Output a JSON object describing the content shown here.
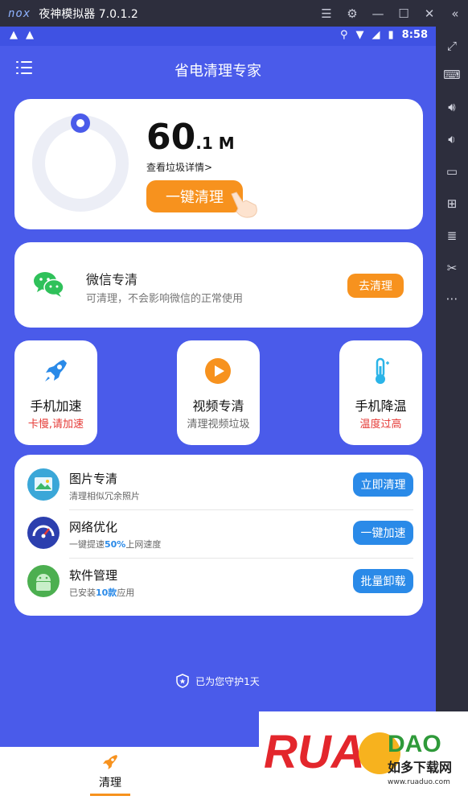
{
  "emulator": {
    "logo": "nox",
    "title": "夜神模拟器 7.0.1.2",
    "controls": [
      "menu-icon",
      "gear-icon",
      "minimize-icon",
      "maximize-icon",
      "close-icon",
      "collapse-icon"
    ]
  },
  "statusbar": {
    "time": "8:58"
  },
  "app": {
    "title": "省电清理专家",
    "junk": {
      "value": "60",
      "decimal": ".1 M",
      "detail_link": "查看垃圾详情>",
      "button": "一键清理"
    },
    "wechat": {
      "title": "微信专清",
      "subtitle": "可清理，不会影响微信的正常使用",
      "button": "去清理"
    },
    "tiles": [
      {
        "title": "手机加速",
        "subtitle": "卡慢,请加速",
        "subtitle_color": "#e53935"
      },
      {
        "title": "视频专清",
        "subtitle": "清理视频垃圾",
        "subtitle_color": "#666666"
      },
      {
        "title": "手机降温",
        "subtitle": "温度过高",
        "subtitle_color": "#e53935"
      }
    ],
    "list": [
      {
        "title": "图片专清",
        "subtitle": "清理相似冗余照片",
        "button": "立即清理"
      },
      {
        "title": "网络优化",
        "subtitle_pre": "一键提速",
        "subtitle_num": "50%",
        "subtitle_post": "上网速度",
        "button": "一键加速"
      },
      {
        "title": "软件管理",
        "subtitle_pre": "已安装",
        "subtitle_num": "10款",
        "subtitle_post": "应用",
        "button": "批量卸载"
      }
    ],
    "guard_text": "已为您守护1天",
    "bottom_nav": {
      "label": "清理"
    }
  },
  "watermark": {
    "brand": "RUADAO",
    "cn": "如多下载网",
    "url": "www.ruaduo.com"
  },
  "colors": {
    "accent_blue": "#4a5bea",
    "orange": "#f7921e",
    "button_blue": "#2a8ae8"
  }
}
